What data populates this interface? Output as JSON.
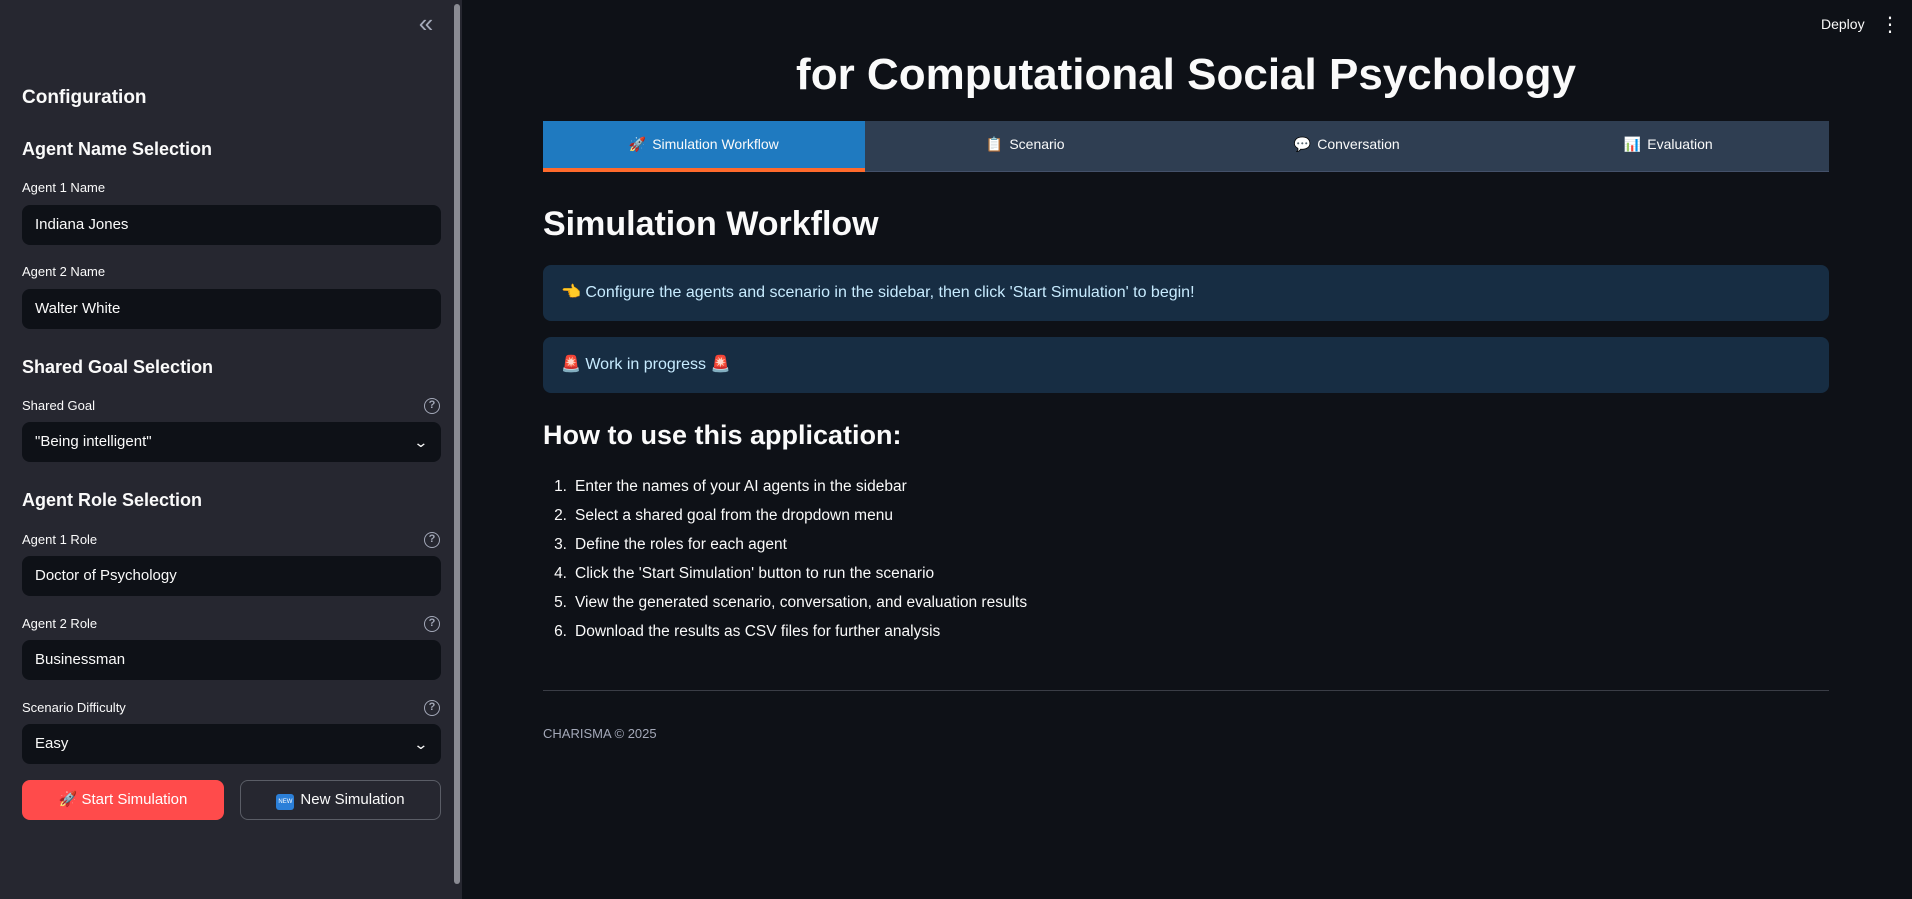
{
  "sidebar": {
    "collapse_icon": "«",
    "heading": "Configuration",
    "agent_name_section": "Agent Name Selection",
    "agent1_name_label": "Agent 1 Name",
    "agent1_name_value": "Indiana Jones",
    "agent2_name_label": "Agent 2 Name",
    "agent2_name_value": "Walter White",
    "shared_goal_section": "Shared Goal Selection",
    "shared_goal_label": "Shared Goal",
    "shared_goal_value": "\"Being intelligent\"",
    "agent_role_section": "Agent Role Selection",
    "agent1_role_label": "Agent 1 Role",
    "agent1_role_value": "Doctor of Psychology",
    "agent2_role_label": "Agent 2 Role",
    "agent2_role_value": "Businessman",
    "difficulty_label": "Scenario Difficulty",
    "difficulty_value": "Easy",
    "start_icon": "🚀",
    "start_label": "Start Simulation",
    "new_icon": "NEW",
    "new_label": "New Simulation"
  },
  "topbar": {
    "deploy_label": "Deploy",
    "menu_icon": "⋮"
  },
  "main": {
    "title": "for Computational Social Psychology",
    "tabs": [
      {
        "icon": "🚀",
        "label": "Simulation Workflow"
      },
      {
        "icon": "📋",
        "label": "Scenario"
      },
      {
        "icon": "💬",
        "label": "Conversation"
      },
      {
        "icon": "📊",
        "label": "Evaluation"
      }
    ],
    "section_title": "Simulation Workflow",
    "info_alert": "👈 Configure the agents and scenario in the sidebar, then click 'Start Simulation' to begin!",
    "wip_alert": "🚨 Work in progress 🚨",
    "howto_title": "How to use this application:",
    "steps": [
      "Enter the names of your AI agents in the sidebar",
      "Select a shared goal from the dropdown menu",
      "Define the roles for each agent",
      "Click the 'Start Simulation' button to run the scenario",
      "View the generated scenario, conversation, and evaluation results",
      "Download the results as CSV files for further analysis"
    ],
    "footer": "CHARISMA © 2025"
  },
  "colors": {
    "primary": "#ff4b4b",
    "tab_active": "#1f7ac0",
    "tab_indicator": "#ff6a2c",
    "alert_bg": "#172d43"
  }
}
